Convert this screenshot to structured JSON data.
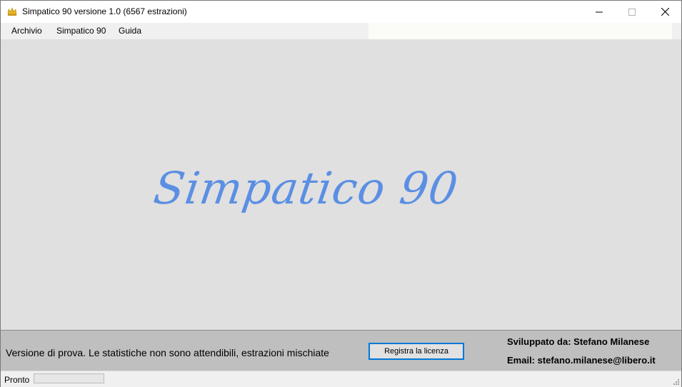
{
  "window": {
    "title": "Simpatico 90 versione 1.0 (6567 estrazioni)",
    "app_icon": "crown-icon"
  },
  "menu": {
    "items": [
      {
        "label": "Archivio"
      },
      {
        "label": "Simpatico 90"
      },
      {
        "label": "Guida"
      }
    ]
  },
  "splash": {
    "logo_text": "Simpatico 90"
  },
  "info": {
    "trial_text": "Versione di prova. Le statistiche non sono attendibili, estrazioni mischiate",
    "license_button": "Registra la licenza",
    "developer": "Sviluppato da: Stefano Milanese",
    "email": "Email: stefano.milanese@libero.it"
  },
  "status": {
    "text": "Pronto",
    "progress": 0
  },
  "colors": {
    "logo": "#5b8fe3",
    "main_bg": "#e0e0e0",
    "panel_bg": "#bfbfbf",
    "accent": "#0078d7"
  }
}
